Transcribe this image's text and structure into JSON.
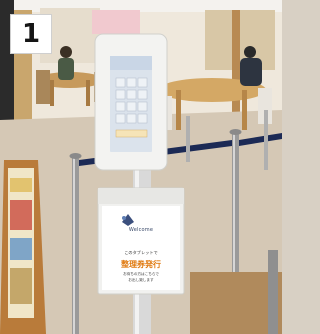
{
  "badge": {
    "number": "1"
  },
  "sign": {
    "brand": "Welcome",
    "line1": "このタブレットで",
    "highlight": "整理券発行",
    "line2": "お待ちの方はこちらで",
    "line3": "お出し致します"
  },
  "colors": {
    "floor": "#d5c8b5",
    "wall": "#efe8dc",
    "kiosk_frame": "#f3f3f1",
    "screen": "#dbe3ec",
    "stanchion_belt": "#1c2a55",
    "highlight": "#e07a10"
  }
}
